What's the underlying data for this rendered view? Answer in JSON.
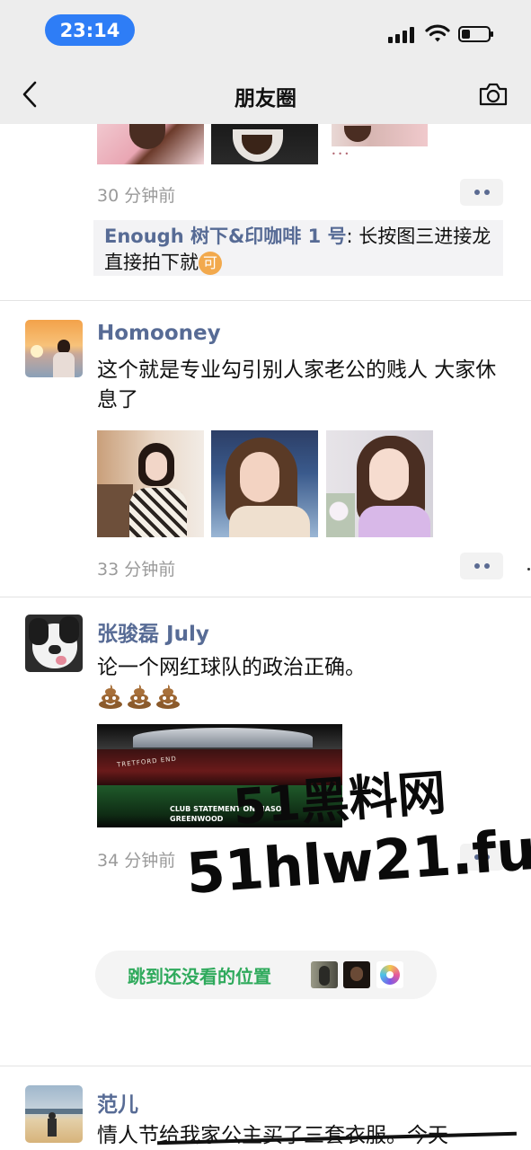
{
  "status": {
    "time": "23:14"
  },
  "header": {
    "title": "朋友圈"
  },
  "post1": {
    "time": "30 分钟前",
    "comment_name": "Enough 树下&印咖啡 1 号",
    "comment_text": ": 长按图三进接龙直接拍下就",
    "comment_emoji": "可"
  },
  "post2": {
    "name": "Homooney",
    "text": "这个就是专业勾引别人家老公的贱人 大家休息了",
    "time": "33 分钟前"
  },
  "post3": {
    "name": "张骏磊 July",
    "text": "论一个网红球队的政治正确。",
    "image_caption_1": "CLUB STATEMENT ON MASON",
    "image_caption_2": "GREENWOOD",
    "stadium_sign": "TRETFORD END",
    "time": "34 分钟前"
  },
  "jump": {
    "label": "跳到还没看的位置"
  },
  "post4": {
    "name": "范儿",
    "text": "情人节给我家公主买了三套衣服。今天"
  },
  "watermark": {
    "line1": "51黑料网",
    "line2": "51hlw21.fun"
  },
  "icons": {
    "back": "chevron-left-icon",
    "camera": "camera-icon",
    "more": "more-dots-icon",
    "reaction": "poop-emoji-icon"
  },
  "colors": {
    "link_name": "#576b95",
    "jump_text": "#2faa5c",
    "time_pill": "#2e7df6",
    "emoji_badge": "#f2a94d"
  }
}
